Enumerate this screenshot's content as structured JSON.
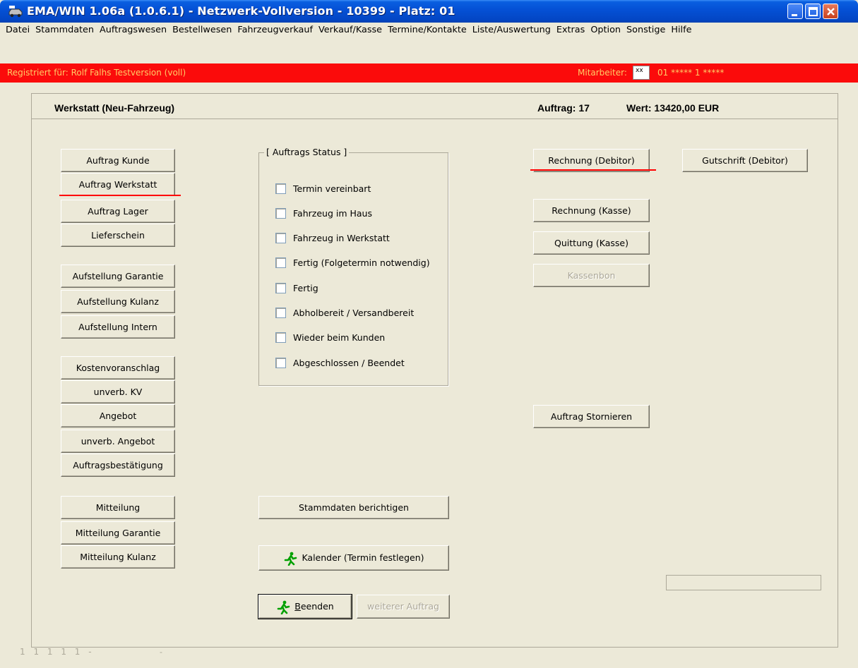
{
  "window": {
    "title": "EMA/WIN  1.06a (1.0.6.1) -  Netzwerk-Vollversion - 10399 - Platz: 01"
  },
  "menu": [
    {
      "label": "Datei"
    },
    {
      "label": "Stammdaten"
    },
    {
      "label": "Auftragswesen"
    },
    {
      "label": "Bestellwesen"
    },
    {
      "label": "Fahrzeugverkauf"
    },
    {
      "label": "Verkauf/Kasse"
    },
    {
      "label": "Termine/Kontakte"
    },
    {
      "label": "Liste/Auswertung"
    },
    {
      "label": "Extras"
    },
    {
      "label": "Option"
    },
    {
      "label": "Sonstige"
    },
    {
      "label": "Hilfe"
    }
  ],
  "registration": {
    "text": "Registriert für: Rolf Falhs Testversion (voll)",
    "employee_label": "Mitarbeiter:",
    "employee_input": "xx",
    "employee_value": "01  ***** 1 *****"
  },
  "header": {
    "title": "Werkstatt (Neu-Fahrzeug)",
    "order": "Auftrag: 17",
    "value": "Wert: 13420,00 EUR"
  },
  "left_buttons": {
    "auftrag_kunde": "Auftrag Kunde",
    "auftrag_werkstatt": "Auftrag Werkstatt",
    "auftrag_lager": "Auftrag Lager",
    "lieferschein": "Lieferschein",
    "aufstellung_garantie": "Aufstellung Garantie",
    "aufstellung_kulanz": "Aufstellung Kulanz",
    "aufstellung_intern": "Aufstellung Intern",
    "kostenvoranschlag": "Kostenvoranschlag",
    "unverb_kv": "unverb. KV",
    "angebot": "Angebot",
    "unverb_angebot": "unverb. Angebot",
    "auftragsbestaetigung": "Auftragsbestätigung",
    "mitteilung": "Mitteilung",
    "mitteilung_garantie": "Mitteilung Garantie",
    "mitteilung_kulanz": "Mitteilung Kulanz"
  },
  "status": {
    "caption": "[ Auftrags Status ]",
    "items": [
      {
        "label": "Termin vereinbart",
        "checked": false
      },
      {
        "label": "Fahrzeug im Haus",
        "checked": false
      },
      {
        "label": "Fahrzeug in Werkstatt",
        "checked": false
      },
      {
        "label": "Fertig (Folgetermin notwendig)",
        "checked": false
      },
      {
        "label": "Fertig",
        "checked": false
      },
      {
        "label": "Abholbereit / Versandbereit",
        "checked": false
      },
      {
        "label": "Wieder beim Kunden",
        "checked": false
      },
      {
        "label": "Abgeschlossen / Beendet",
        "checked": false
      }
    ]
  },
  "center_buttons": {
    "stammdaten": "Stammdaten berichtigen",
    "kalender": "Kalender (Termin festlegen)",
    "beenden_prefix": "B",
    "beenden_rest": "eenden",
    "weiterer": "weiterer Auftrag"
  },
  "right_buttons": {
    "rechnung_debitor": "Rechnung (Debitor)",
    "gutschrift_debitor": "Gutschrift (Debitor)",
    "rechnung_kasse": "Rechnung (Kasse)",
    "quittung_kasse": "Quittung (Kasse)",
    "kassenbon": "Kassenbon",
    "stornieren": "Auftrag Stornieren"
  },
  "footer": {
    "status": "1 1 1 1 1  -",
    "dash": "-"
  }
}
